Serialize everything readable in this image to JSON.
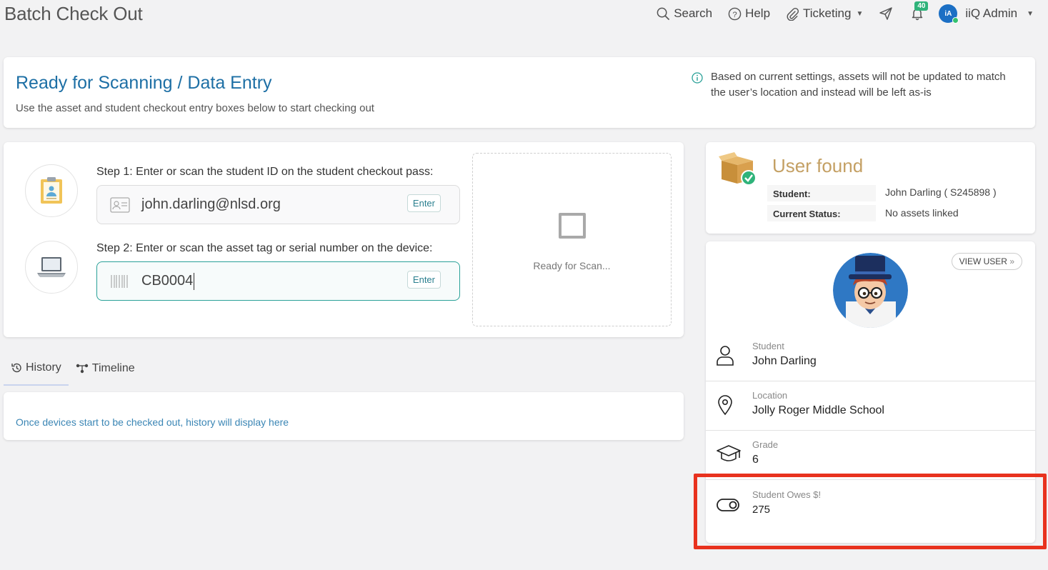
{
  "page": {
    "title": "Batch Check Out"
  },
  "topnav": {
    "search_label": "Search",
    "help_label": "Help",
    "ticketing_label": "Ticketing",
    "notifications_count": "40",
    "user_initials": "iA",
    "user_name": "iiQ Admin"
  },
  "banner": {
    "title": "Ready for Scanning / Data Entry",
    "subtitle": "Use the asset and student checkout entry boxes below to start checking out",
    "note": "Based on current settings, assets will not be updated to match the user’s location and instead will be left as-is"
  },
  "steps": {
    "step1_label": "Step 1:  Enter or scan the student ID on the student checkout pass:",
    "step1_value": "john.darling@nlsd.org",
    "step2_label": "Step 2:  Enter or scan the asset tag or serial number on the device:",
    "step2_value": "CB0004",
    "enter_label": "Enter",
    "scan_status": "Ready for Scan..."
  },
  "tabs": [
    {
      "label": "History"
    },
    {
      "label": "Timeline"
    }
  ],
  "history": {
    "empty_text": "Once devices start to be checked out, history will display here"
  },
  "user_found": {
    "title": "User found",
    "student_label": "Student:",
    "student_value": "John Darling ( S245898 )",
    "status_label": "Current Status:",
    "status_value": "No assets linked"
  },
  "profile": {
    "view_user_label": "VIEW USER",
    "rows": [
      {
        "label": "Student",
        "value": "John Darling"
      },
      {
        "label": "Location",
        "value": "Jolly Roger Middle School"
      },
      {
        "label": "Grade",
        "value": "6"
      },
      {
        "label": "Student Owes $!",
        "value": "275"
      }
    ]
  },
  "colors": {
    "accent": "#1d6fa5",
    "found": "#c4a064",
    "highlight": "#e8321e",
    "badge": "#2fb37a"
  }
}
